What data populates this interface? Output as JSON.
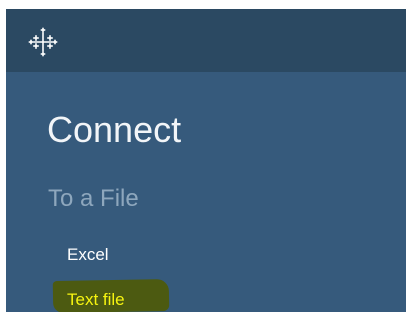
{
  "header": {
    "logo_icon": "tableau-cross-logo-icon"
  },
  "connect": {
    "title": "Connect",
    "section_label": "To a File",
    "items": [
      {
        "label": "Excel"
      },
      {
        "label": "Text file",
        "highlighted": true
      }
    ]
  },
  "colors": {
    "topbar": "#2b4962",
    "panel": "#365a7c",
    "section_text": "#8ea7bd",
    "highlight_marker": "#4c5a11",
    "highlight_text": "#f6f410"
  }
}
